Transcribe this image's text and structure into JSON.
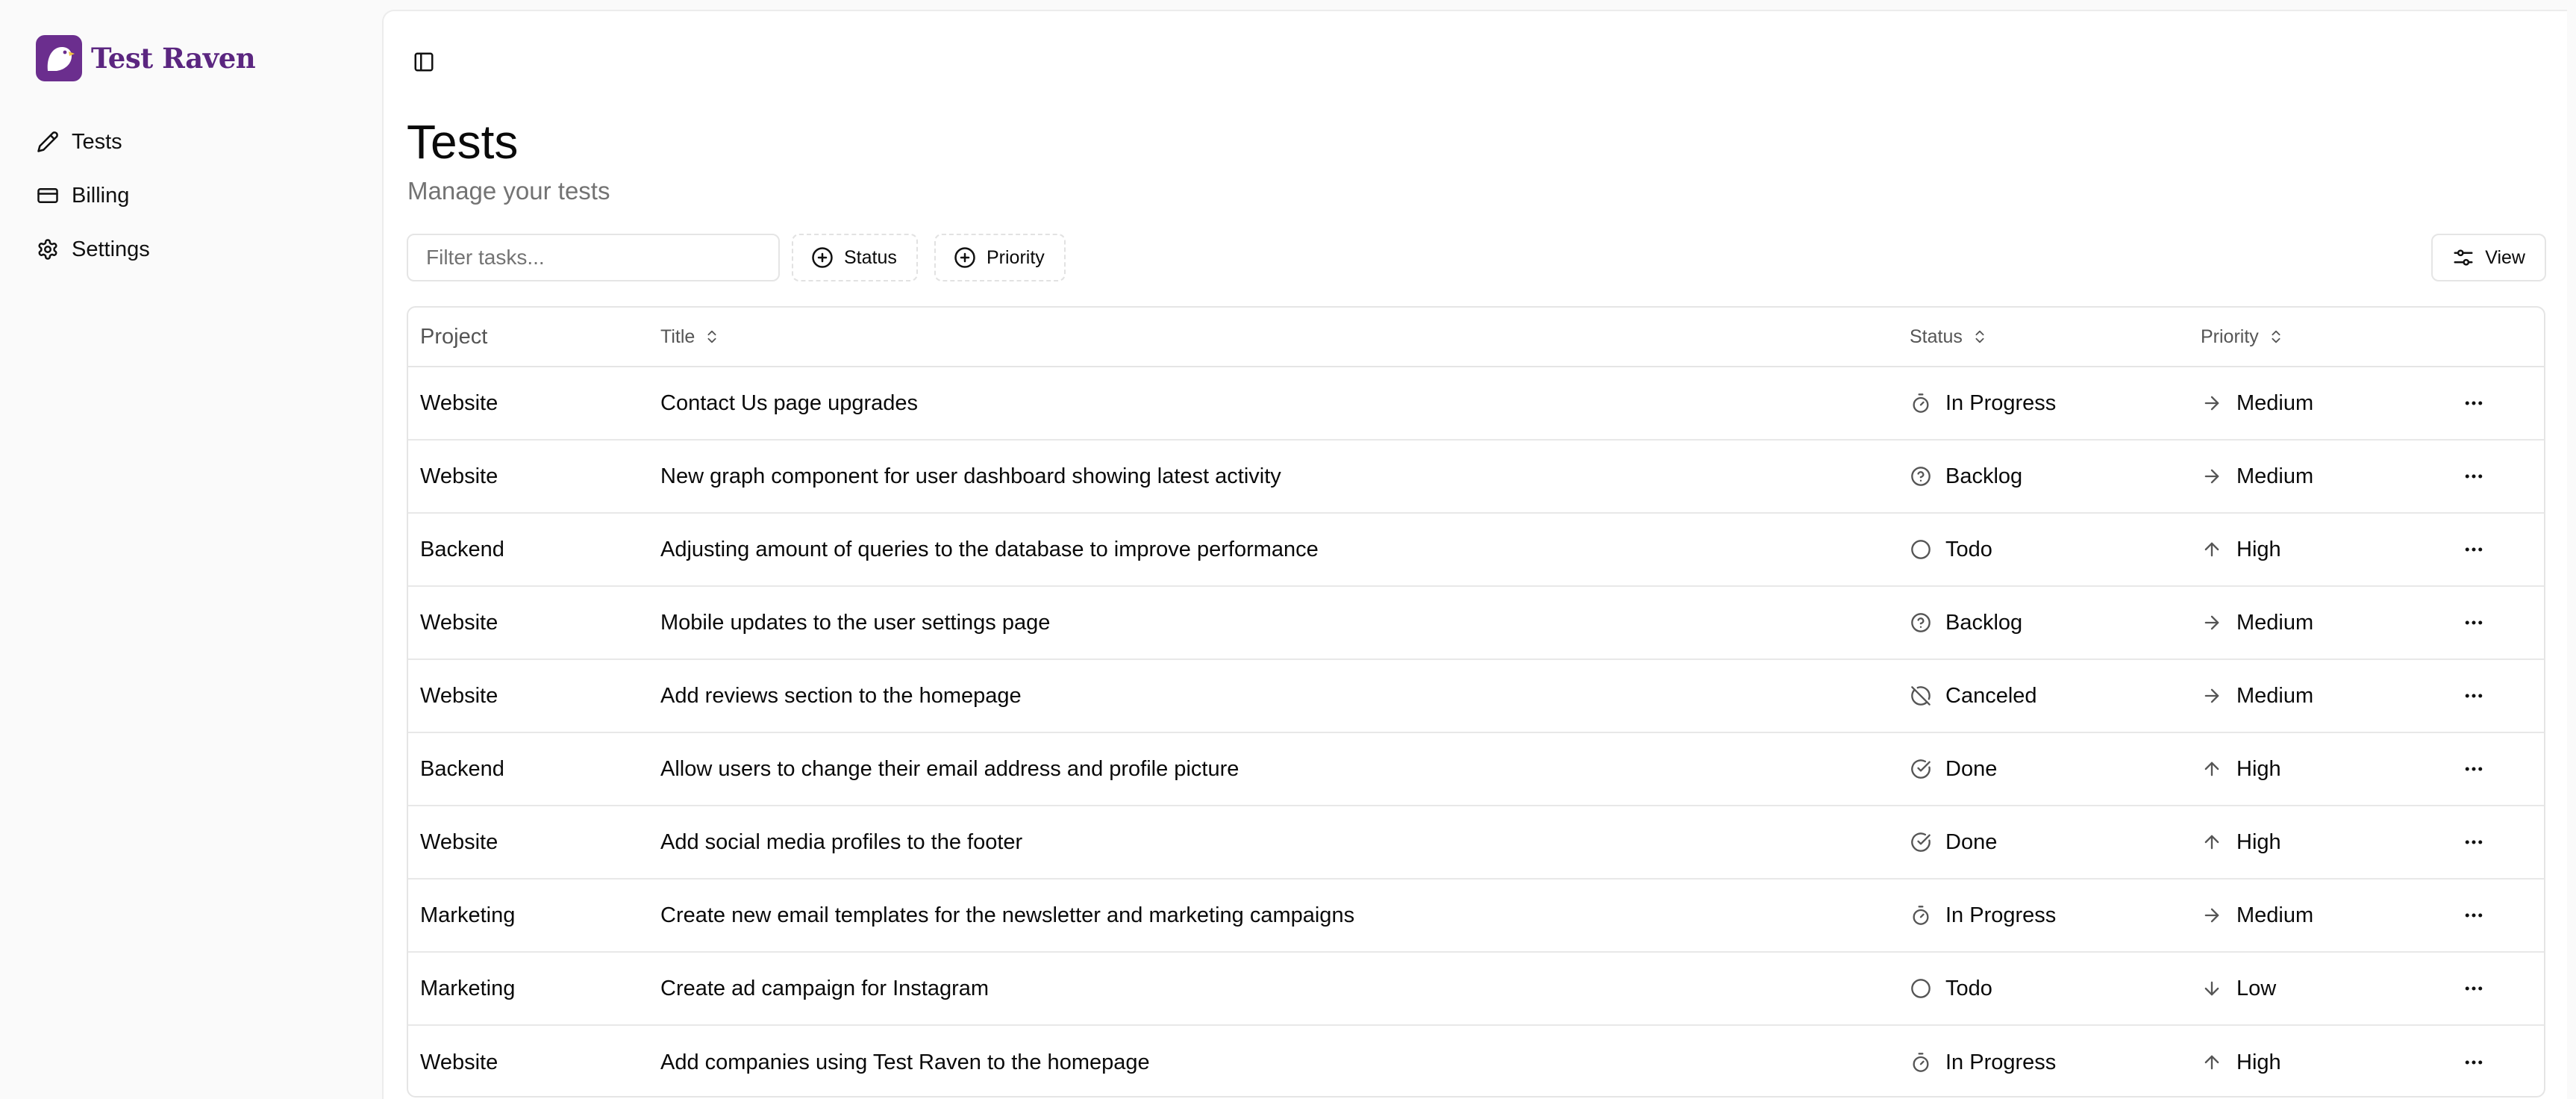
{
  "brand": {
    "name": "Test Raven",
    "accent": "#6b2e8e"
  },
  "sidebar": {
    "items": [
      {
        "label": "Tests",
        "icon": "pencil-icon"
      },
      {
        "label": "Billing",
        "icon": "credit-card-icon"
      },
      {
        "label": "Settings",
        "icon": "gear-icon"
      }
    ]
  },
  "page": {
    "title": "Tests",
    "subtitle": "Manage your tests"
  },
  "toolbar": {
    "filter_placeholder": "Filter tasks...",
    "status_label": "Status",
    "priority_label": "Priority",
    "view_label": "View"
  },
  "table": {
    "headers": {
      "project": "Project",
      "title": "Title",
      "status": "Status",
      "priority": "Priority"
    },
    "rows": [
      {
        "project": "Website",
        "title": "Contact Us page upgrades",
        "status": "In Progress",
        "status_icon": "timer-icon",
        "priority": "Medium",
        "priority_icon": "arrow-right-icon"
      },
      {
        "project": "Website",
        "title": "New graph component for user dashboard showing latest activity",
        "status": "Backlog",
        "status_icon": "help-circle-icon",
        "priority": "Medium",
        "priority_icon": "arrow-right-icon"
      },
      {
        "project": "Backend",
        "title": "Adjusting amount of queries to the database to improve performance",
        "status": "Todo",
        "status_icon": "circle-icon",
        "priority": "High",
        "priority_icon": "arrow-up-icon"
      },
      {
        "project": "Website",
        "title": "Mobile updates to the user settings page",
        "status": "Backlog",
        "status_icon": "help-circle-icon",
        "priority": "Medium",
        "priority_icon": "arrow-right-icon"
      },
      {
        "project": "Website",
        "title": "Add reviews section to the homepage",
        "status": "Canceled",
        "status_icon": "circle-off-icon",
        "priority": "Medium",
        "priority_icon": "arrow-right-icon"
      },
      {
        "project": "Backend",
        "title": "Allow users to change their email address and profile picture",
        "status": "Done",
        "status_icon": "check-circle-icon",
        "priority": "High",
        "priority_icon": "arrow-up-icon"
      },
      {
        "project": "Website",
        "title": "Add social media profiles to the footer",
        "status": "Done",
        "status_icon": "check-circle-icon",
        "priority": "High",
        "priority_icon": "arrow-up-icon"
      },
      {
        "project": "Marketing",
        "title": "Create new email templates for the newsletter and marketing campaigns",
        "status": "In Progress",
        "status_icon": "timer-icon",
        "priority": "Medium",
        "priority_icon": "arrow-right-icon"
      },
      {
        "project": "Marketing",
        "title": "Create ad campaign for Instagram",
        "status": "Todo",
        "status_icon": "circle-icon",
        "priority": "Low",
        "priority_icon": "arrow-down-icon"
      },
      {
        "project": "Website",
        "title": "Add companies using Test Raven to the homepage",
        "status": "In Progress",
        "status_icon": "timer-icon",
        "priority": "High",
        "priority_icon": "arrow-up-icon"
      }
    ]
  }
}
